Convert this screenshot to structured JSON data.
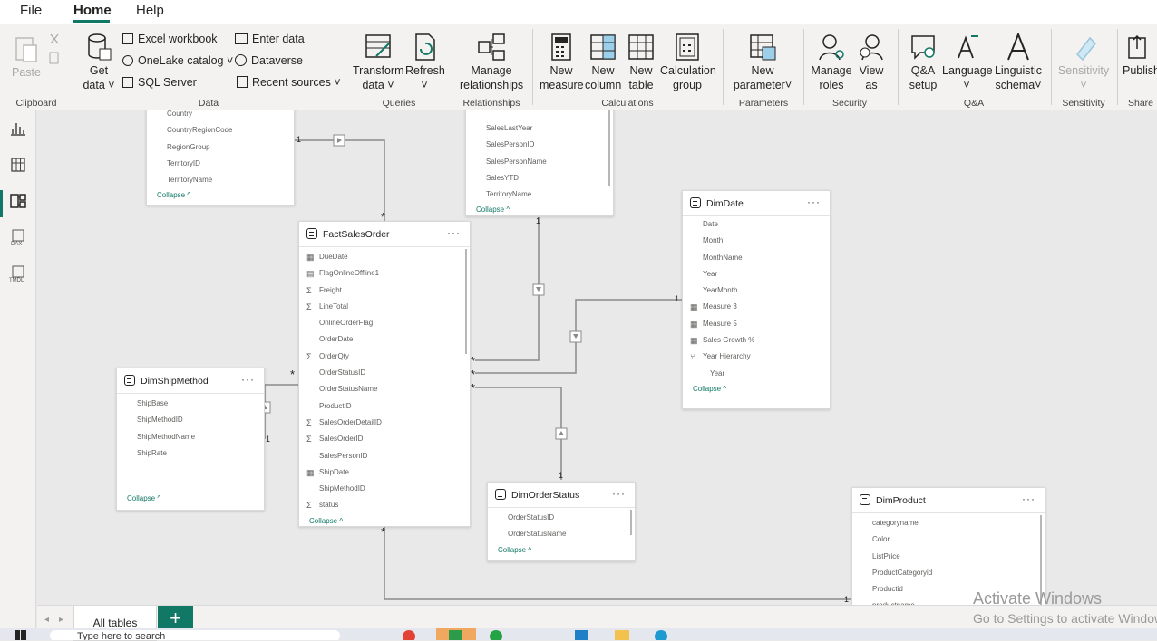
{
  "menu": {
    "file": "File",
    "home": "Home",
    "help": "Help"
  },
  "ribbon": {
    "clipboard": {
      "paste": "Paste",
      "label": "Clipboard"
    },
    "data": {
      "get_data_1": "Get",
      "get_data_2": "data",
      "excel": "Excel workbook",
      "onelake": "OneLake catalog",
      "sql": "SQL Server",
      "enter_data": "Enter data",
      "dataverse": "Dataverse",
      "recent": "Recent sources",
      "label": "Data"
    },
    "queries": {
      "transform_1": "Transform",
      "transform_2": "data",
      "refresh": "Refresh",
      "label": "Queries"
    },
    "relationships": {
      "manage_1": "Manage",
      "manage_2": "relationships",
      "label": "Relationships"
    },
    "calculations": {
      "new_measure_1": "New",
      "new_measure_2": "measure",
      "new_column_1": "New",
      "new_column_2": "column",
      "new_table_1": "New",
      "new_table_2": "table",
      "calc_group_1": "Calculation",
      "calc_group_2": "group",
      "label": "Calculations"
    },
    "parameters": {
      "new_param_1": "New",
      "new_param_2": "parameter",
      "label": "Parameters"
    },
    "security": {
      "manage_roles_1": "Manage",
      "manage_roles_2": "roles",
      "view_as_1": "View",
      "view_as_2": "as",
      "label": "Security"
    },
    "qa": {
      "qa_setup_1": "Q&A",
      "qa_setup_2": "setup",
      "language": "Language",
      "linguistic_1": "Linguistic",
      "linguistic_2": "schema",
      "label": "Q&A"
    },
    "sensitivity": {
      "sensitivity": "Sensitivity",
      "label": "Sensitivity"
    },
    "share": {
      "publish": "Publish",
      "label": "Share"
    }
  },
  "tables": {
    "territory": {
      "fields": [
        "Country",
        "CountryRegionCode",
        "RegionGroup",
        "TerritoryID",
        "TerritoryName"
      ],
      "collapse": "Collapse"
    },
    "salesperson": {
      "fields": [
        "SalesLastYear",
        "SalesPersonID",
        "SalesPersonName",
        "SalesYTD",
        "TerritoryName"
      ],
      "collapse": "Collapse"
    },
    "factsalesorder": {
      "title": "FactSalesOrder",
      "fields": [
        "DueDate",
        "FlagOnlineOffline1",
        "Freight",
        "LineTotal",
        "OnlineOrderFlag",
        "OrderDate",
        "OrderQty",
        "OrderStatusID",
        "OrderStatusName",
        "ProductID",
        "SalesOrderDetailID",
        "SalesOrderID",
        "SalesPersonID",
        "ShipDate",
        "ShipMethodID",
        "status"
      ],
      "collapse": "Collapse"
    },
    "dimdate": {
      "title": "DimDate",
      "fields": [
        "Date",
        "Month",
        "MonthName",
        "Year",
        "YearMonth",
        "Measure 3",
        "Measure 5",
        "Sales Growth %",
        "Year Hierarchy",
        "Year"
      ],
      "collapse": "Collapse"
    },
    "dimshipmethod": {
      "title": "DimShipMethod",
      "fields": [
        "ShipBase",
        "ShipMethodID",
        "ShipMethodName",
        "ShipRate"
      ],
      "collapse": "Collapse"
    },
    "dimorderstatus": {
      "title": "DimOrderStatus",
      "fields": [
        "OrderStatusID",
        "OrderStatusName"
      ],
      "collapse": "Collapse"
    },
    "dimproduct": {
      "title": "DimProduct",
      "fields": [
        "categoryname",
        "Color",
        "ListPrice",
        "ProductCategoryid",
        "Productid",
        "productname"
      ]
    }
  },
  "relationship_marks": {
    "one": "1",
    "many": "*"
  },
  "tabs": {
    "all_tables": "All tables",
    "add": "+"
  },
  "windows": {
    "activate_title": "Activate Windows",
    "activate_sub": "Go to Settings to activate Windows.",
    "search": "Type here to search"
  },
  "colors": {
    "accent": "#117865",
    "ribbon_bg": "#f3f2f1",
    "canvas_bg": "#e9e9e9"
  }
}
